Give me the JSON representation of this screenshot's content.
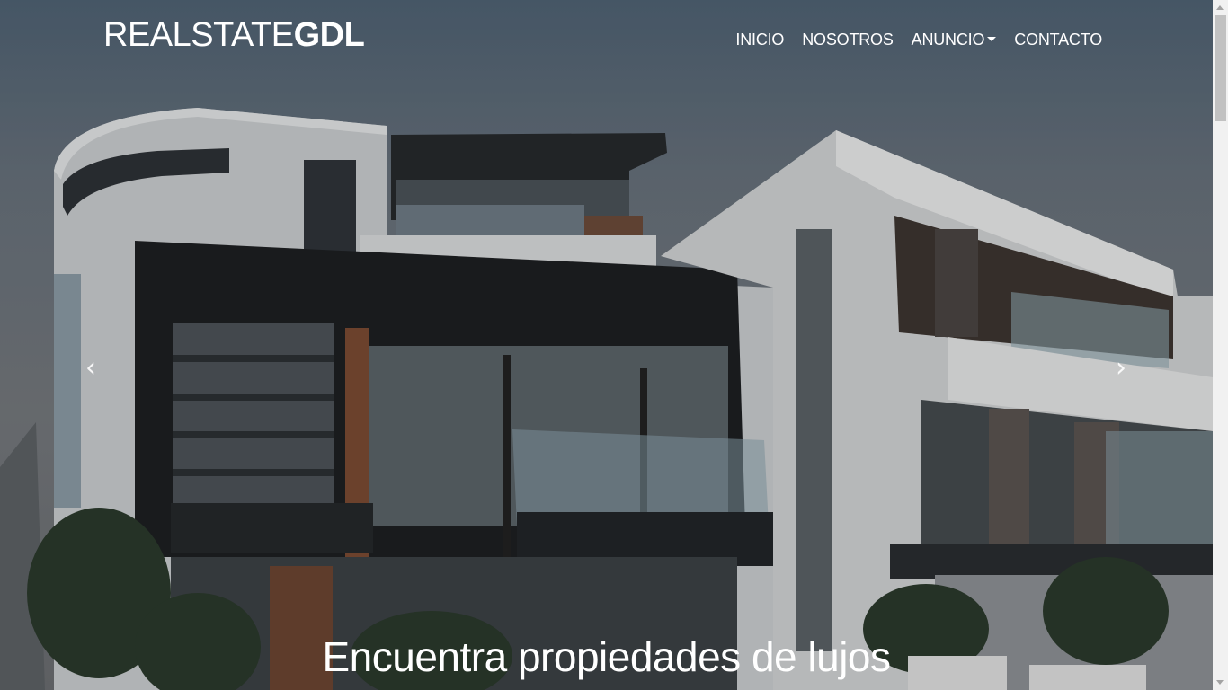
{
  "brand": {
    "light": "REALSTATE",
    "bold": "GDL"
  },
  "nav": {
    "items": [
      {
        "label": "INICIO"
      },
      {
        "label": "NOSOTROS"
      },
      {
        "label": "ANUNCIO",
        "has_dropdown": true
      },
      {
        "label": "CONTACTO"
      }
    ]
  },
  "carousel": {
    "prev_icon": "chevron-left-icon",
    "next_icon": "chevron-right-icon",
    "prev_glyph": "‹",
    "next_glyph": "›",
    "caption": "Encuentra propiedades de lujos"
  },
  "colors": {
    "nav_text": "#ffffff",
    "overlay": "rgba(0,0,0,0.12)"
  }
}
